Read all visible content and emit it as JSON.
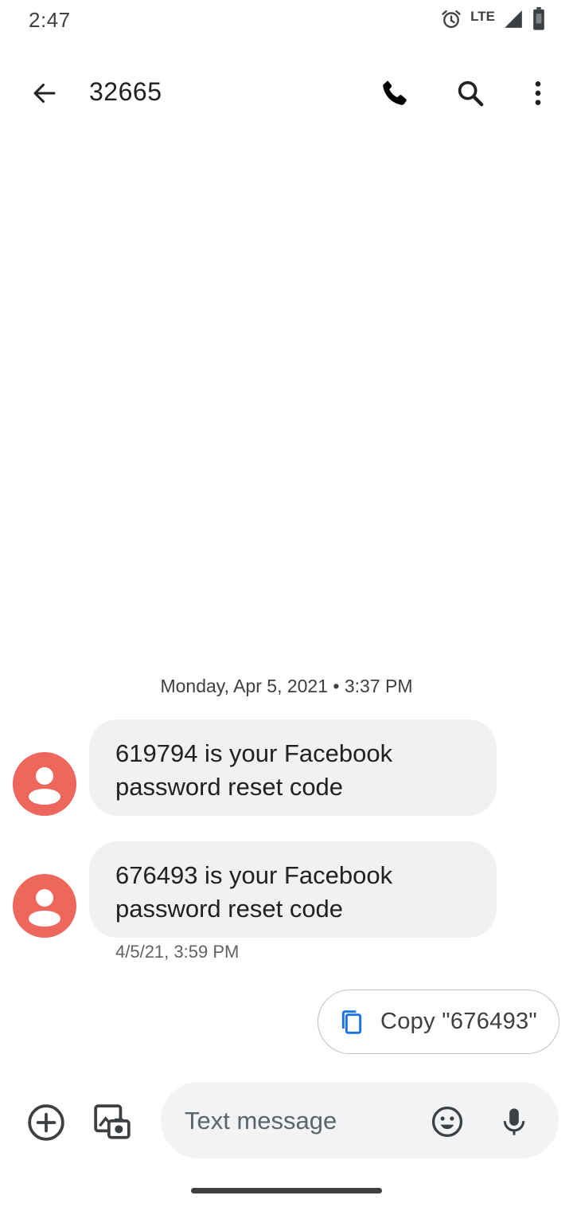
{
  "status_bar": {
    "time": "2:47",
    "network": "LTE",
    "icons": [
      "alarm-icon",
      "signal-icon",
      "battery-icon"
    ]
  },
  "app_bar": {
    "title": "32665",
    "icons": [
      "back-arrow-icon",
      "phone-icon",
      "search-icon",
      "more-vert-icon"
    ]
  },
  "conversation": {
    "date_separator": "Monday, Apr 5, 2021 • 3:37 PM",
    "messages": [
      {
        "line1": "619794 is your Facebook",
        "line2": "password reset code",
        "timestamp": ""
      },
      {
        "line1": "676493 is your Facebook",
        "line2": "password reset code",
        "timestamp": "4/5/21, 3:59 PM"
      }
    ],
    "avatar_color": "#ee675c"
  },
  "smart_reply": {
    "label": "Copy \"676493\"",
    "icon": "copy-icon",
    "icon_color": "#1a73e8"
  },
  "compose": {
    "placeholder": "Text message",
    "value": "",
    "icons": [
      "add-circle-icon",
      "gallery-camera-icon",
      "emoji-icon",
      "mic-icon"
    ]
  }
}
